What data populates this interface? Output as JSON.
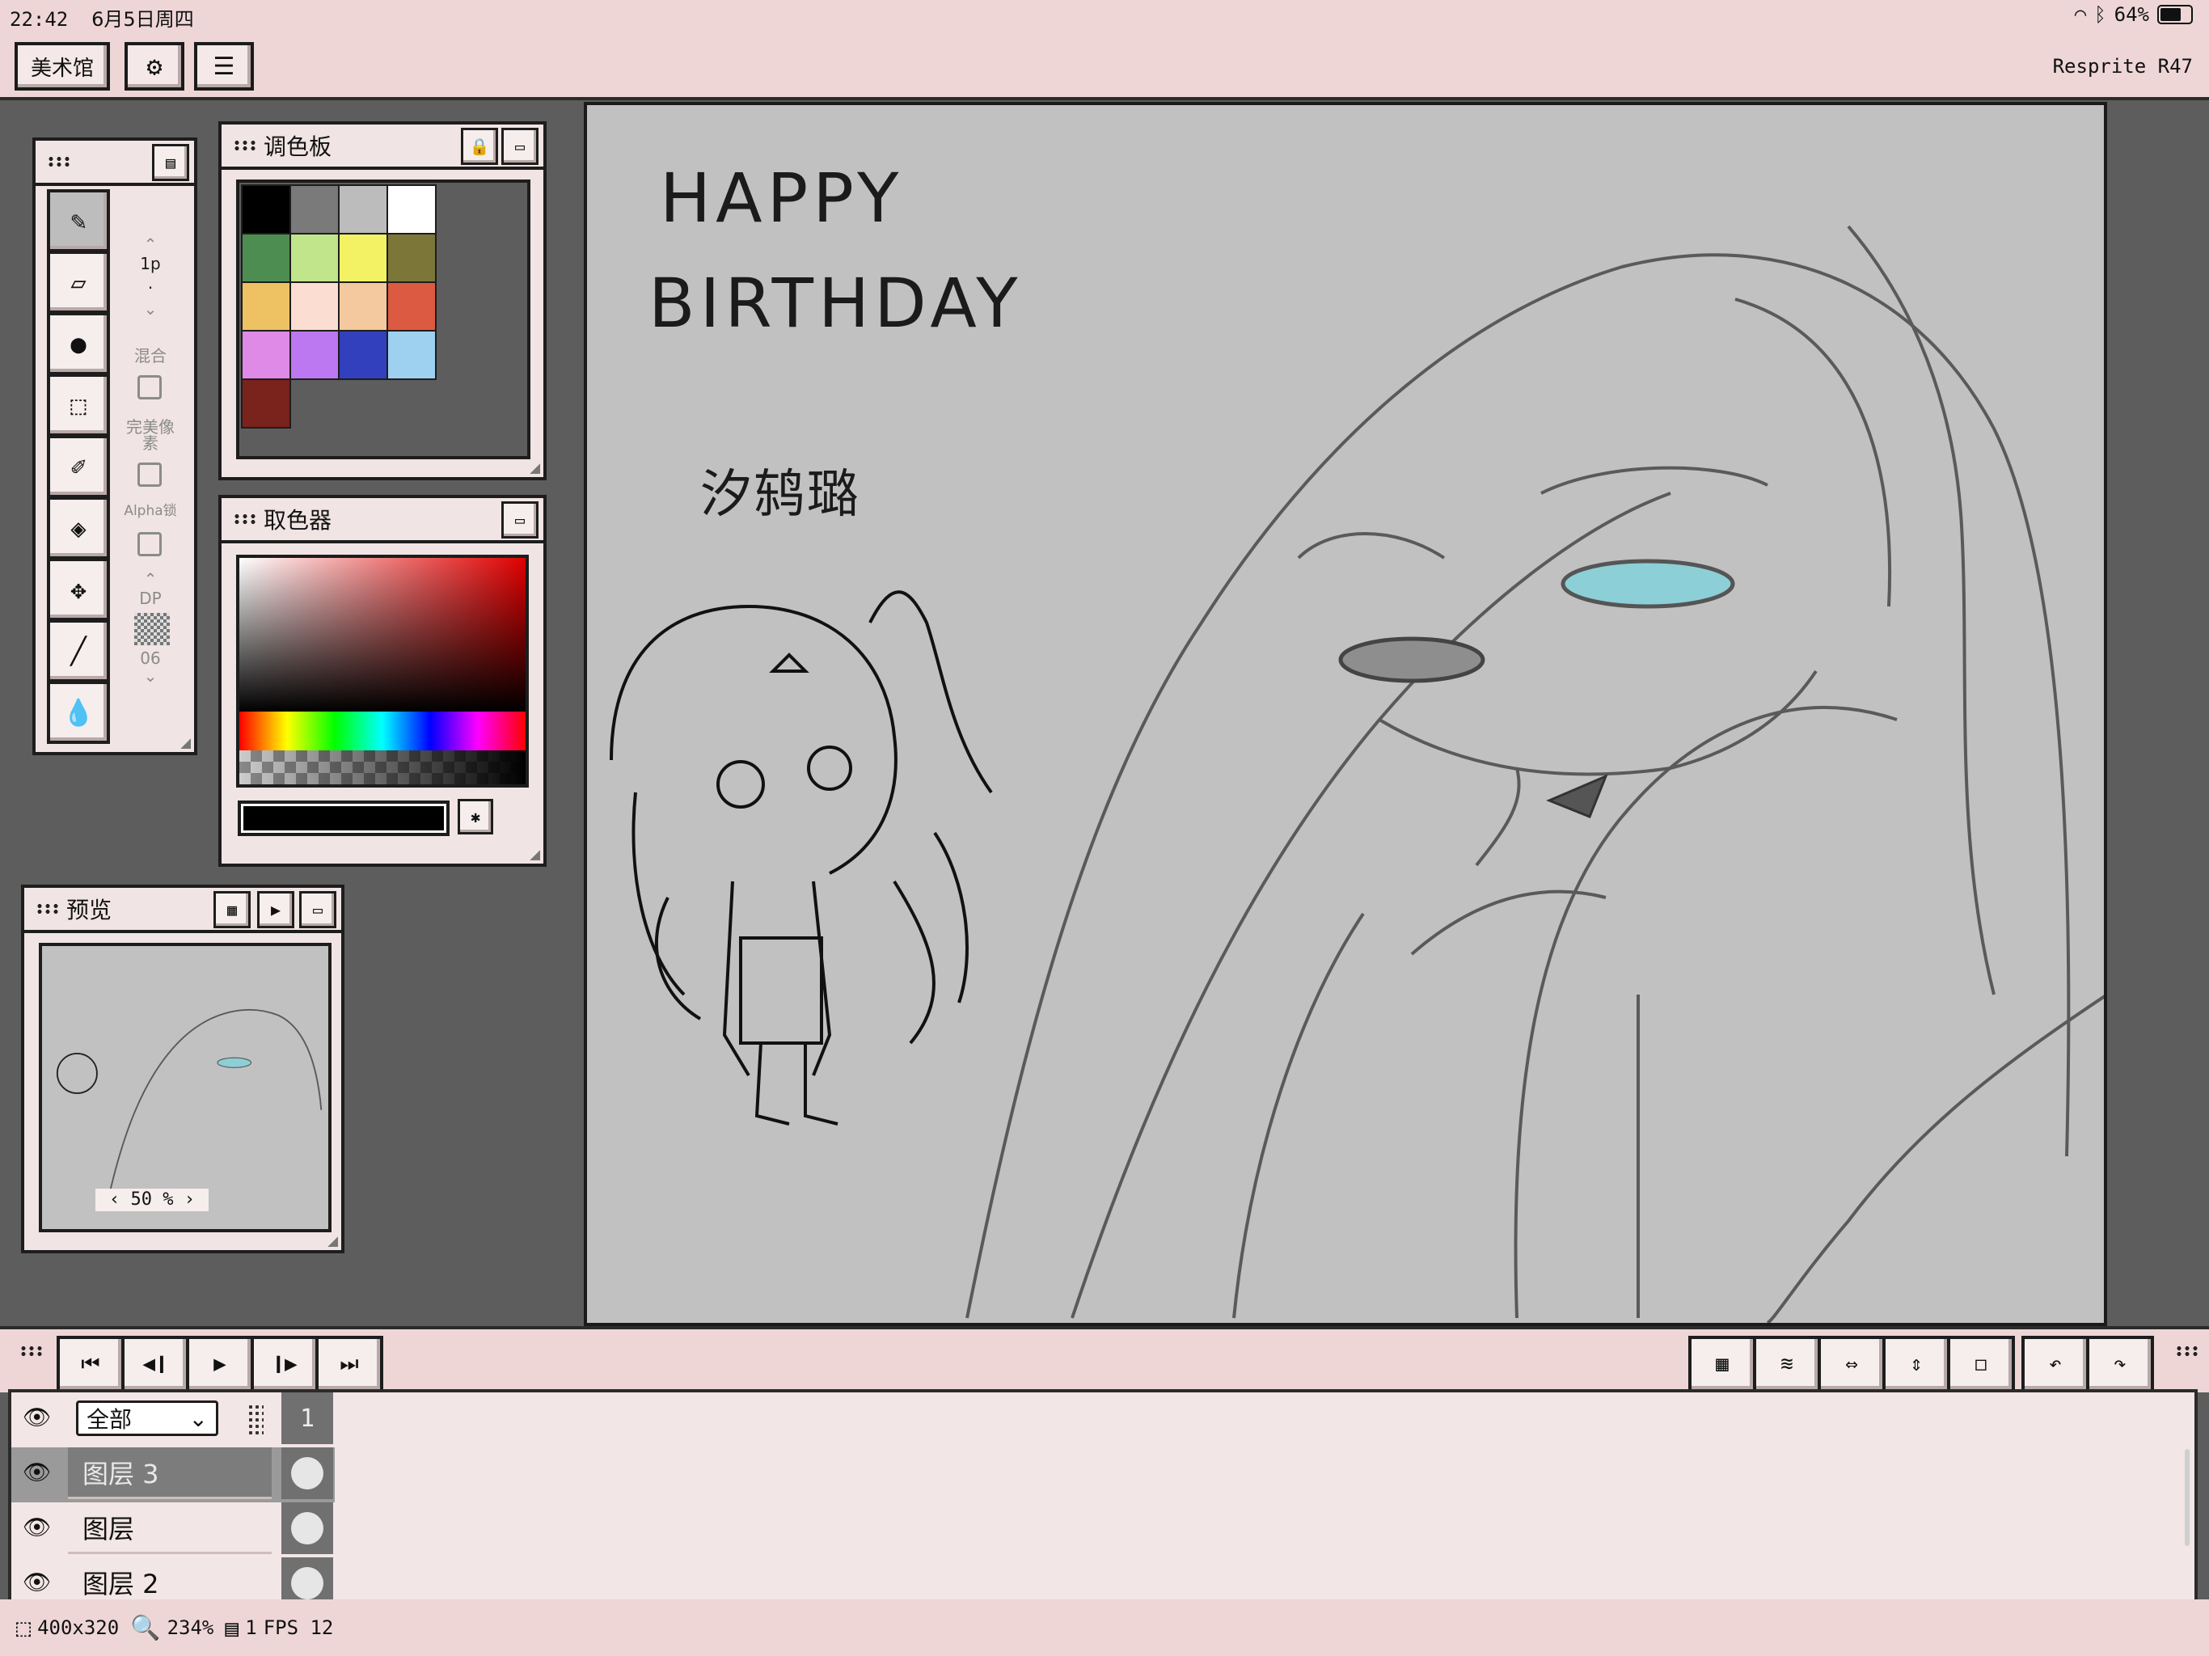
{
  "status_bar": {
    "time": "22:42",
    "date": "6月5日周四",
    "wifi_icon": "wifi-icon",
    "bluetooth_icon": "bluetooth-icon",
    "battery": "64%"
  },
  "toolbar": {
    "gallery_label": "美术馆",
    "app_version": "Resprite R47"
  },
  "tools_panel": {
    "brush_size": "1p",
    "blend_label": "混合",
    "perfect_pixel_label": "完美像素",
    "alpha_lock_label": "Alpha锁",
    "dp_label": "DP",
    "dither_value": "06"
  },
  "palette_panel": {
    "title": "调色板",
    "colors": [
      "#000000",
      "#7a7a7a",
      "#bcbcbc",
      "#ffffff",
      "#4e8d51",
      "#c1e58b",
      "#f3f264",
      "#7c7739",
      "#eec162",
      "#fbded1",
      "#f4c9a0",
      "#dc5a41",
      "#df8ae6",
      "#bb78f0",
      "#3340bd",
      "#9ed1ef",
      "#7a221c"
    ]
  },
  "picker_panel": {
    "title": "取色器"
  },
  "preview_panel": {
    "title": "预览",
    "zoom": "50 %"
  },
  "canvas": {
    "text_line1": "HAPPY",
    "text_line2": "BIRTHDAY",
    "signature": "汐鸫璐"
  },
  "layers": {
    "filter_select": "全部",
    "frame_number": "1",
    "items": [
      {
        "name": "图层 3",
        "active": true
      },
      {
        "name": "图层",
        "active": false
      },
      {
        "name": "图层 2",
        "active": false
      }
    ]
  },
  "bottom_bar": {
    "canvas_size": "400x320",
    "zoom": "234%",
    "frame_count": "1",
    "fps": "FPS 12"
  },
  "colors": {
    "background": "#5d5d5d",
    "chrome": "#eed6d6",
    "panel": "#f1e4e4",
    "canvas": "#c1c1c1",
    "eye_highlight": "#8ccfd6"
  }
}
